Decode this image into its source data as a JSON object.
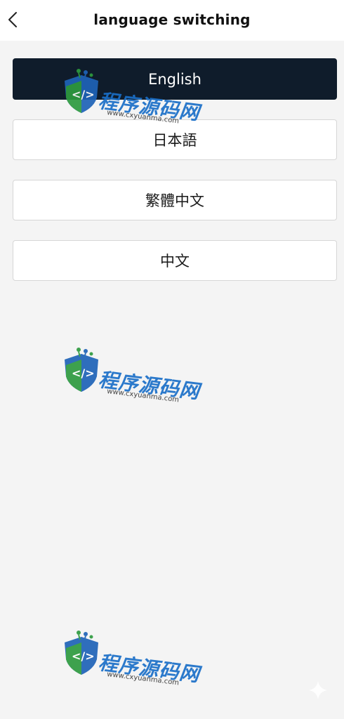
{
  "header": {
    "title": "language switching",
    "back_icon": "chevron-left-icon"
  },
  "languages": [
    {
      "label": "English",
      "selected": true
    },
    {
      "label": "日本語",
      "selected": false
    },
    {
      "label": "繁體中文",
      "selected": false
    },
    {
      "label": "中文",
      "selected": false
    }
  ],
  "watermark": {
    "brand": "程序源码网",
    "url": "www.cxyuanma.com"
  },
  "colors": {
    "selected_bg": "#0f1c2b",
    "background": "#f4f4f4",
    "watermark_blue": "#1a6fc8"
  }
}
